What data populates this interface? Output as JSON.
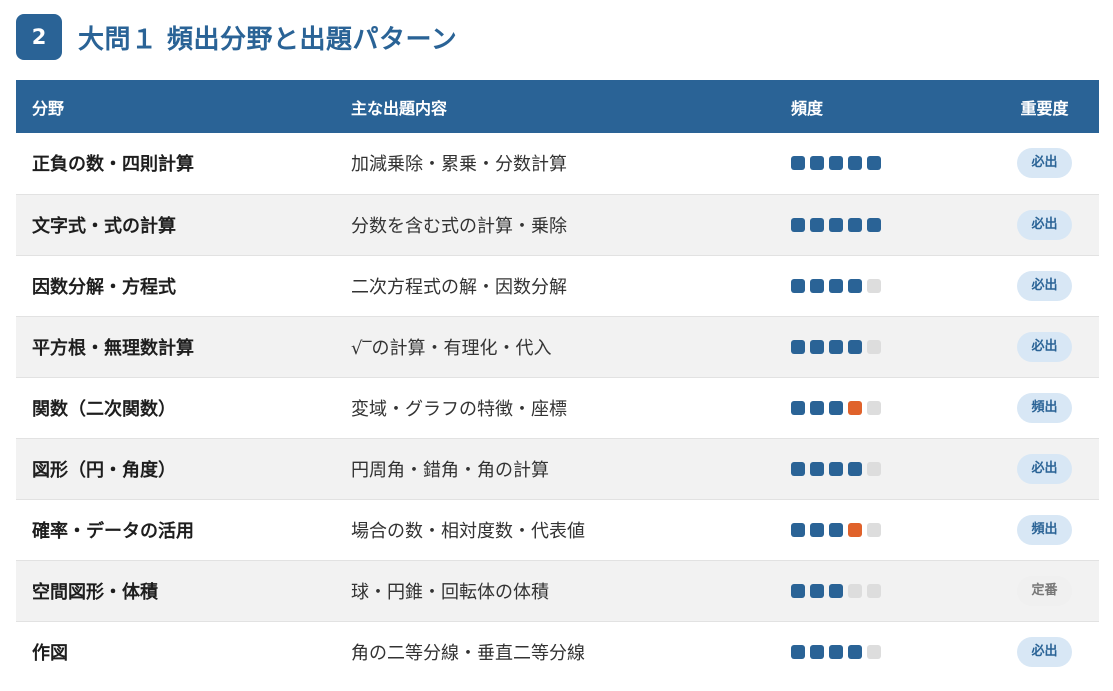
{
  "section": {
    "number": "2",
    "title": "大問１ 頻出分野と出題パターン"
  },
  "table": {
    "headers": {
      "field": "分野",
      "content": "主な出題内容",
      "frequency": "頻度",
      "importance": "重要度"
    },
    "frequency_max": 5,
    "colors": {
      "header_bg": "#2a6396",
      "dot_filled": "#2a6396",
      "dot_highlight": "#e0622b",
      "dot_empty": "#dddddd"
    },
    "rows": [
      {
        "field": "正負の数・四則計算",
        "content": "加減乗除・累乗・分数計算",
        "frequency": 5,
        "highlight": false,
        "importance": "必出",
        "importance_style": "blue"
      },
      {
        "field": "文字式・式の計算",
        "content": "分数を含む式の計算・乗除",
        "frequency": 5,
        "highlight": false,
        "importance": "必出",
        "importance_style": "blue"
      },
      {
        "field": "因数分解・方程式",
        "content": "二次方程式の解・因数分解",
        "frequency": 4,
        "highlight": false,
        "importance": "必出",
        "importance_style": "blue"
      },
      {
        "field": "平方根・無理数計算",
        "content": "√‾の計算・有理化・代入",
        "frequency": 4,
        "highlight": false,
        "importance": "必出",
        "importance_style": "blue"
      },
      {
        "field": "関数（二次関数）",
        "content": "変域・グラフの特徴・座標",
        "frequency": 4,
        "highlight": true,
        "importance": "頻出",
        "importance_style": "blue"
      },
      {
        "field": "図形（円・角度）",
        "content": "円周角・錯角・角の計算",
        "frequency": 4,
        "highlight": false,
        "importance": "必出",
        "importance_style": "blue"
      },
      {
        "field": "確率・データの活用",
        "content": "場合の数・相対度数・代表値",
        "frequency": 4,
        "highlight": true,
        "importance": "頻出",
        "importance_style": "blue"
      },
      {
        "field": "空間図形・体積",
        "content": "球・円錐・回転体の体積",
        "frequency": 3,
        "highlight": false,
        "importance": "定番",
        "importance_style": "gray"
      },
      {
        "field": "作図",
        "content": "角の二等分線・垂直二等分線",
        "frequency": 4,
        "highlight": false,
        "importance": "必出",
        "importance_style": "blue"
      }
    ]
  }
}
